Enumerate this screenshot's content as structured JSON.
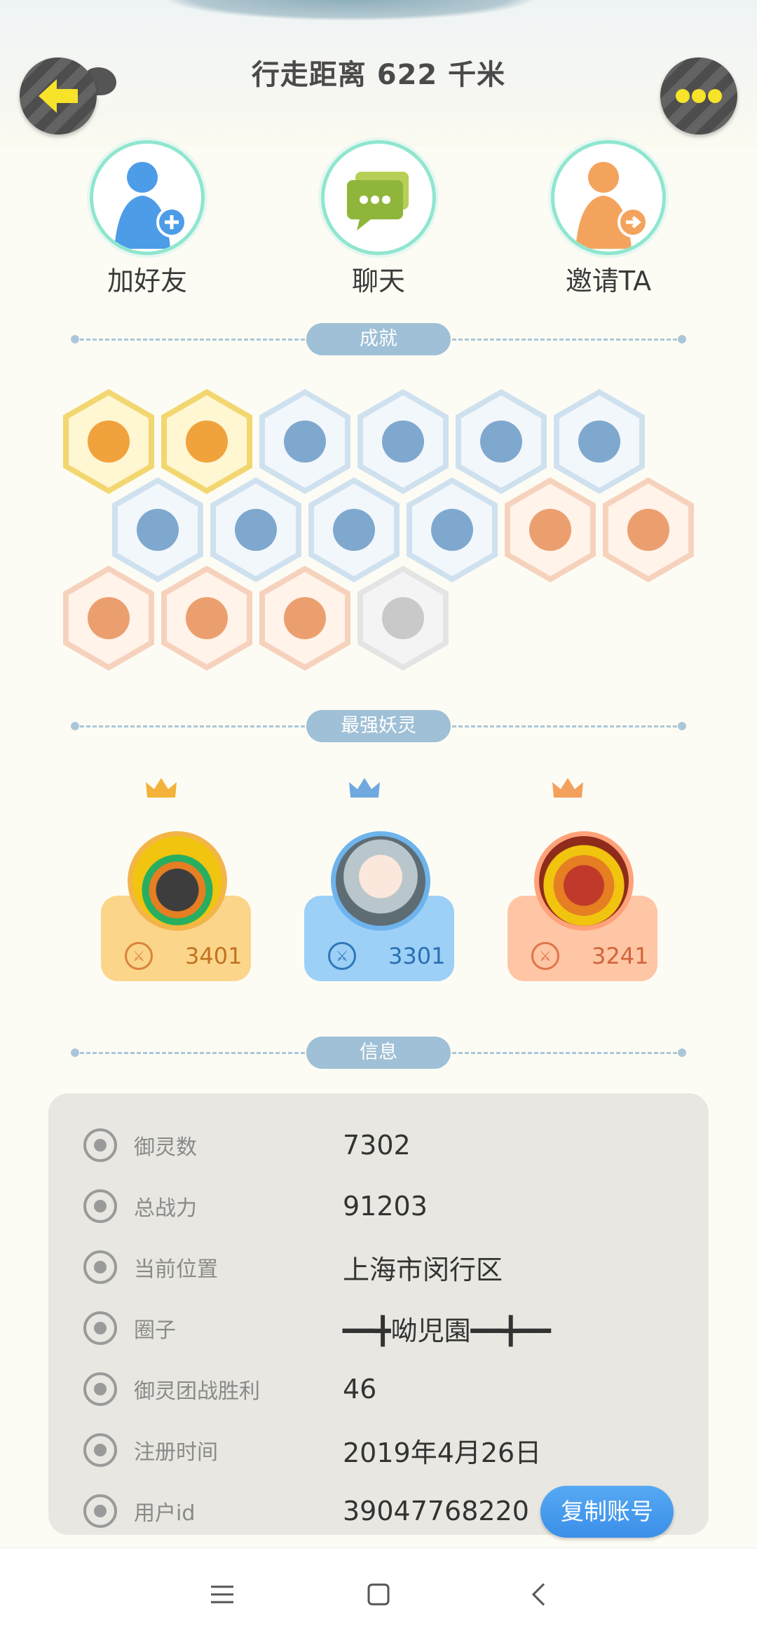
{
  "header": {
    "distance_text": "行走距离 622 千米"
  },
  "actions": [
    {
      "label": "加好友",
      "icon": "add-friend-icon"
    },
    {
      "label": "聊天",
      "icon": "chat-icon"
    },
    {
      "label": "邀请TA",
      "icon": "invite-icon"
    }
  ],
  "sections": {
    "achievements": "成就",
    "strongest": "最强妖灵",
    "info": "信息"
  },
  "strongest_spirits": [
    {
      "power": "3401",
      "color": "#fbd58a"
    },
    {
      "power": "3301",
      "color": "#9cd0f7"
    },
    {
      "power": "3241",
      "color": "#ffc6a5"
    }
  ],
  "info": {
    "spirits_count": {
      "label": "御灵数",
      "value": "7302"
    },
    "total_power": {
      "label": "总战力",
      "value": "91203"
    },
    "location": {
      "label": "当前位置",
      "value": "上海市闵行区"
    },
    "circle": {
      "label": "圈子",
      "value": "━━╋呦児園━━╋━━"
    },
    "team_wins": {
      "label": "御灵团战胜利",
      "value": "46"
    },
    "register_time": {
      "label": "注册时间",
      "value": "2019年4月26日"
    },
    "user_id": {
      "label": "用户id",
      "value": "39047768220"
    },
    "copy_button": "复制账号"
  },
  "colors": {
    "accent_blue": "#3a8fe8",
    "section_pill": "#9fc0d6",
    "action_ring": "#8fe6cf"
  }
}
